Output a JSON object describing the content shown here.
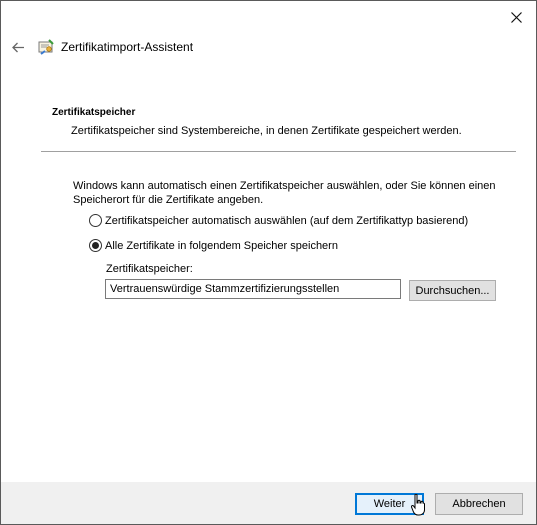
{
  "window": {
    "title": "Zertifikatimport-Assistent"
  },
  "icons": {
    "close": "close-icon",
    "back": "back-arrow-icon",
    "app": "certificate-icon"
  },
  "section": {
    "title": "Zertifikatspeicher",
    "description": "Zertifikatspeicher sind Systembereiche, in denen Zertifikate gespeichert werden."
  },
  "content": {
    "info": "Windows kann automatisch einen Zertifikatspeicher auswählen, oder Sie können einen Speicherort für die Zertifikate angeben.",
    "options": [
      {
        "label": "Zertifikatspeicher automatisch auswählen (auf dem Zertifikattyp basierend)",
        "checked": false
      },
      {
        "label": "Alle Zertifikate in folgendem Speicher speichern",
        "checked": true
      }
    ],
    "store_label": "Zertifikatspeicher:",
    "store_value": "Vertrauenswürdige Stammzertifizierungsstellen",
    "browse_label": "Durchsuchen..."
  },
  "footer": {
    "next_label": "Weiter",
    "cancel_label": "Abbrechen"
  },
  "colors": {
    "accent": "#0078d7",
    "footer_bg": "#f0f0f0",
    "button_bg": "#e1e1e1"
  }
}
